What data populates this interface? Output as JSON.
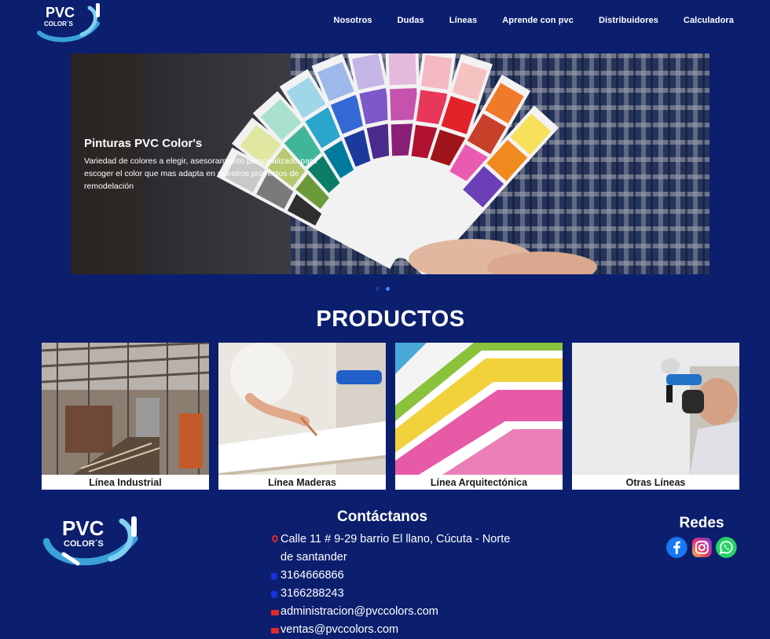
{
  "nav": {
    "brand_text_1": "PVC",
    "brand_text_2": "COLOR´S",
    "items": [
      "Nosotros",
      "Dudas",
      "Líneas",
      "Aprende con pvc",
      "Distribuidores",
      "Calculadora"
    ]
  },
  "hero": {
    "title": "Pinturas PVC Color's",
    "subtitle": "Variedad de colores a elegir, asesoramiento personalizado para escoger el color que mas adapta en nuestros proyectos de remodelación",
    "slides": 2,
    "active_slide": 2
  },
  "products": {
    "title": "PRODUCTOS",
    "cards": [
      {
        "label": "Línea Industrial"
      },
      {
        "label": "Línea Maderas"
      },
      {
        "label": "Línea Arquitectónica"
      },
      {
        "label": "Otras Líneas"
      }
    ]
  },
  "footer": {
    "brand_text_1": "PVC",
    "brand_text_2": "COLOR´S",
    "contact_title": "Contáctanos",
    "address": "Calle 11 # 9-29 barrio El llano, Cúcuta - Norte de santander",
    "phone_1": "3164666866",
    "phone_2": "3166288243",
    "email_1": "administracion@pvccolors.com",
    "email_2": "ventas@pvccolors.com",
    "social_title": "Redes"
  },
  "colors": {
    "background": "#0b1f6e",
    "accent_dot": "#3d8bff",
    "facebook": "#1877f2",
    "whatsapp": "#25d366",
    "icon_red": "#e02a2a",
    "icon_blue": "#1733d8"
  }
}
